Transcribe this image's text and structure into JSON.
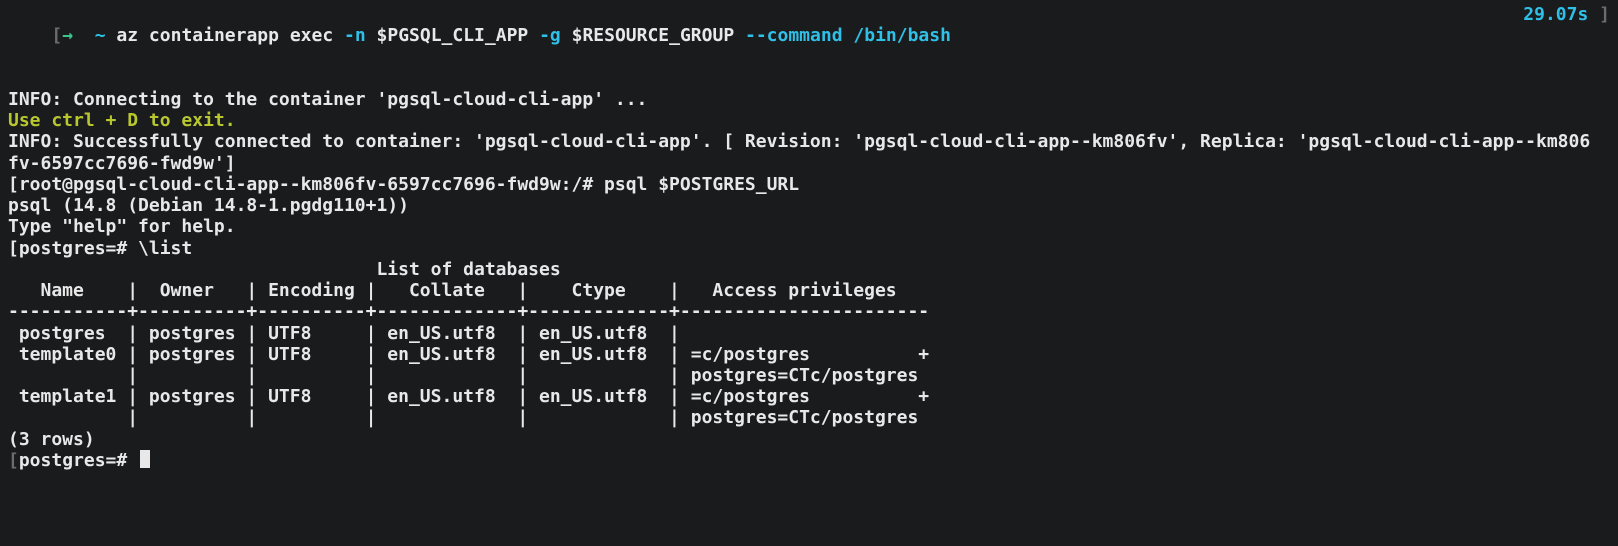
{
  "topline": {
    "bracket_open": "[",
    "arrow": "→",
    "tilde": "~",
    "cmd_part1": "az containerapp exec ",
    "opt_n": "-n",
    "env_app": " $PGSQL_CLI_APP ",
    "opt_g": "-g",
    "env_rg": " $RESOURCE_GROUP ",
    "opt_cmd": "--command",
    "sp": " ",
    "path": "/bin/bash",
    "time": "29.07s",
    "bracket_close": "]"
  },
  "lines": {
    "info1": "INFO: Connecting to the container 'pgsql-cloud-cli-app' ...",
    "hint": "Use ctrl + D to exit.",
    "info2a": "INFO: Successfully connected to container: 'pgsql-cloud-cli-app'. [ Revision: 'pgsql-cloud-cli-app--km806fv', Replica: 'pgsql-cloud-cli-app--km806",
    "info2b": "fv-6597cc7696-fwd9w']",
    "shell_prompt": "[root@pgsql-cloud-cli-app--km806fv-6597cc7696-fwd9w:/# psql $POSTGRES_URL",
    "psql_ver": "psql (14.8 (Debian 14.8-1.pgdg110+1))",
    "psql_help": "Type \"help\" for help.",
    "blank": "",
    "list_cmd": "[postgres=# \\list",
    "title": "                                  List of databases",
    "header": "   Name    |  Owner   | Encoding |   Collate   |    Ctype    |   Access privileges",
    "sep": "-----------+----------+----------+-------------+-------------+-----------------------",
    "row_pg": " postgres  | postgres | UTF8     | en_US.utf8  | en_US.utf8  |",
    "row_t0a": " template0 | postgres | UTF8     | en_US.utf8  | en_US.utf8  | =c/postgres          +",
    "row_t0b": "           |          |          |             |             | postgres=CTc/postgres",
    "row_t1a": " template1 | postgres | UTF8     | en_US.utf8  | en_US.utf8  | =c/postgres          +",
    "row_t1b": "           |          |          |             |             | postgres=CTc/postgres",
    "rowcount": "(3 rows)",
    "final_prompt": "postgres=# "
  },
  "chart_data": {
    "type": "table",
    "title": "List of databases",
    "columns": [
      "Name",
      "Owner",
      "Encoding",
      "Collate",
      "Ctype",
      "Access privileges"
    ],
    "rows": [
      {
        "Name": "postgres",
        "Owner": "postgres",
        "Encoding": "UTF8",
        "Collate": "en_US.utf8",
        "Ctype": "en_US.utf8",
        "Access privileges": ""
      },
      {
        "Name": "template0",
        "Owner": "postgres",
        "Encoding": "UTF8",
        "Collate": "en_US.utf8",
        "Ctype": "en_US.utf8",
        "Access privileges": "=c/postgres\npostgres=CTc/postgres"
      },
      {
        "Name": "template1",
        "Owner": "postgres",
        "Encoding": "UTF8",
        "Collate": "en_US.utf8",
        "Ctype": "en_US.utf8",
        "Access privileges": "=c/postgres\npostgres=CTc/postgres"
      }
    ],
    "row_count_text": "(3 rows)"
  }
}
